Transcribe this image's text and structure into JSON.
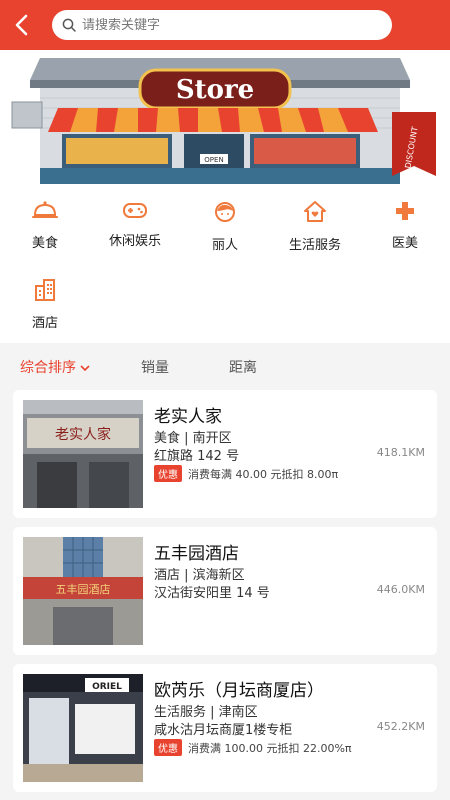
{
  "search": {
    "placeholder": "请搜索关键字"
  },
  "banner": {
    "sign_text": "Store",
    "ribbon_text": "DISCOUNT",
    "door_sign": "OPEN"
  },
  "categories": [
    {
      "label": "美食",
      "icon": "food-dome-icon"
    },
    {
      "label": "休闲娱乐",
      "icon": "gamepad-icon"
    },
    {
      "label": "丽人",
      "icon": "woman-face-icon"
    },
    {
      "label": "生活服务",
      "icon": "home-heart-icon"
    },
    {
      "label": "医美",
      "icon": "medical-cross-icon"
    },
    {
      "label": "酒店",
      "icon": "hotel-building-icon"
    }
  ],
  "sort": {
    "items": [
      "综合排序",
      "销量",
      "距离"
    ]
  },
  "stores": [
    {
      "name": "老实人家",
      "category_area": "美食 | 南开区",
      "address": "红旗路 142 号",
      "distance": "418.1KM",
      "promo_tag": "优惠",
      "promo_text": "消费每满 40.00 元抵扣 8.00π",
      "thumb_text": "老实人家"
    },
    {
      "name": "五丰园酒店",
      "category_area": "酒店 | 滨海新区",
      "address": "汉沽街安阳里 14 号",
      "distance": "446.0KM",
      "promo_tag": "",
      "promo_text": "",
      "thumb_text": "五丰园酒店"
    },
    {
      "name": "欧芮乐（月坛商厦店）",
      "category_area": "生活服务 | 津南区",
      "address": "咸水沽月坛商厦1楼专柜",
      "distance": "452.2KM",
      "promo_tag": "优惠",
      "promo_text": "消费满 100.00 元抵扣 22.00%π",
      "thumb_text": "ORIEL"
    }
  ],
  "colors": {
    "accent": "#e8432f",
    "icon_orange": "#f07a3c"
  }
}
